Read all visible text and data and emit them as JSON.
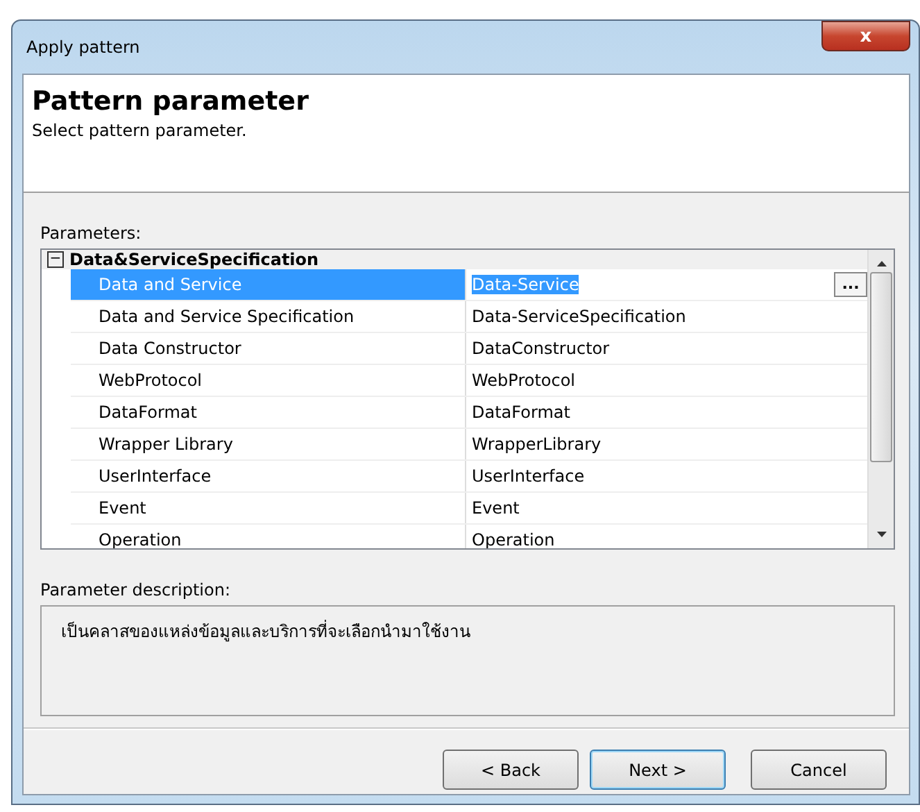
{
  "window": {
    "title": "Apply pattern",
    "close": "x"
  },
  "header": {
    "title": "Pattern parameter",
    "subtitle": "Select pattern parameter."
  },
  "parameters": {
    "label": "Parameters:",
    "category": {
      "toggle": "−",
      "name": "Data&ServiceSpecification",
      "expanded": true
    },
    "rows": [
      {
        "name": "Data and Service",
        "value": "Data-Service",
        "selected": true,
        "browse": "..."
      },
      {
        "name": "Data and Service Specification",
        "value": "Data-ServiceSpecification",
        "selected": false
      },
      {
        "name": "Data Constructor",
        "value": "DataConstructor",
        "selected": false
      },
      {
        "name": "WebProtocol",
        "value": "WebProtocol",
        "selected": false
      },
      {
        "name": "DataFormat",
        "value": "DataFormat",
        "selected": false
      },
      {
        "name": "Wrapper Library",
        "value": "WrapperLibrary",
        "selected": false
      },
      {
        "name": "UserInterface",
        "value": "UserInterface",
        "selected": false
      },
      {
        "name": "Event",
        "value": "Event",
        "selected": false
      },
      {
        "name": "Operation",
        "value": "Operation",
        "selected": false
      }
    ]
  },
  "description": {
    "label": "Parameter description:",
    "text": "เป็นคลาสของแหล่งข้อมูลและบริการที่จะเลือกนำมาใช้งาน"
  },
  "buttons": [
    {
      "label": "< Back",
      "default": false
    },
    {
      "label": "Next >",
      "default": true
    },
    {
      "label": "Cancel",
      "default": false
    }
  ]
}
